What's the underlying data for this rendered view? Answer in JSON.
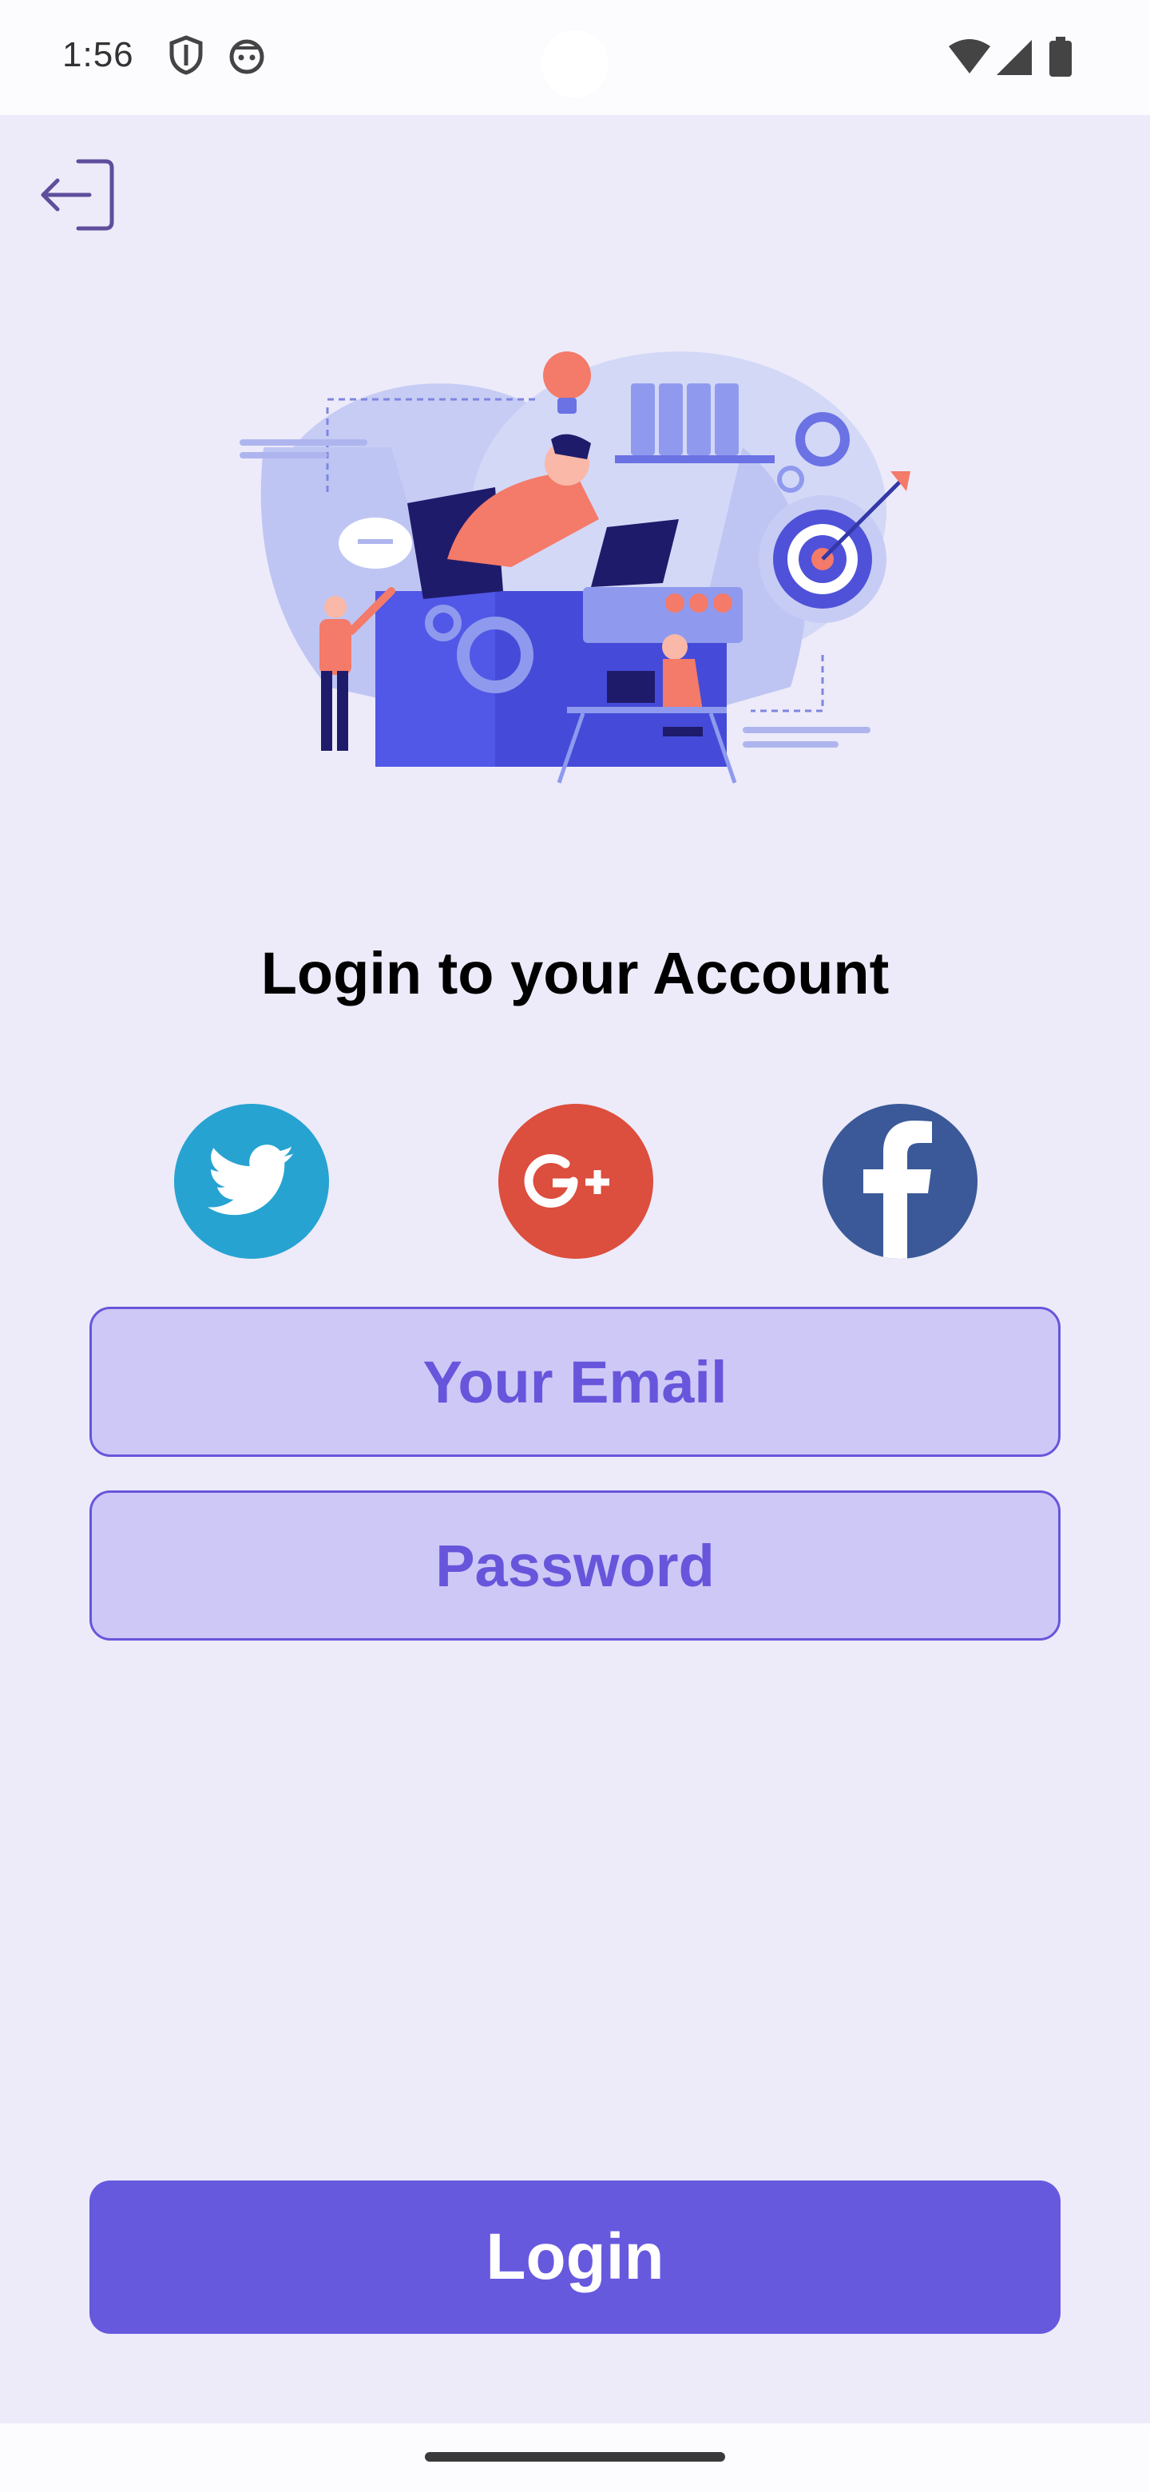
{
  "status_bar": {
    "time": "1:56",
    "icons": [
      "shield-icon",
      "android-face-icon",
      "wifi-icon",
      "cellular-signal-icon",
      "battery-icon"
    ]
  },
  "header": {
    "back_icon": "logout-arrow-icon"
  },
  "illustration": {
    "name": "team-workspace-illustration"
  },
  "login": {
    "title": "Login to your Account",
    "social": [
      {
        "name": "twitter",
        "color": "#27A3D2"
      },
      {
        "name": "google-plus",
        "color": "#DC4E3D"
      },
      {
        "name": "facebook",
        "color": "#3B5998"
      }
    ],
    "email_placeholder": "Your Email",
    "password_placeholder": "Password",
    "button_label": "Login"
  },
  "colors": {
    "background": "#EDEBF9",
    "accent": "#6756DB",
    "input_fill": "#CEC8F7"
  }
}
